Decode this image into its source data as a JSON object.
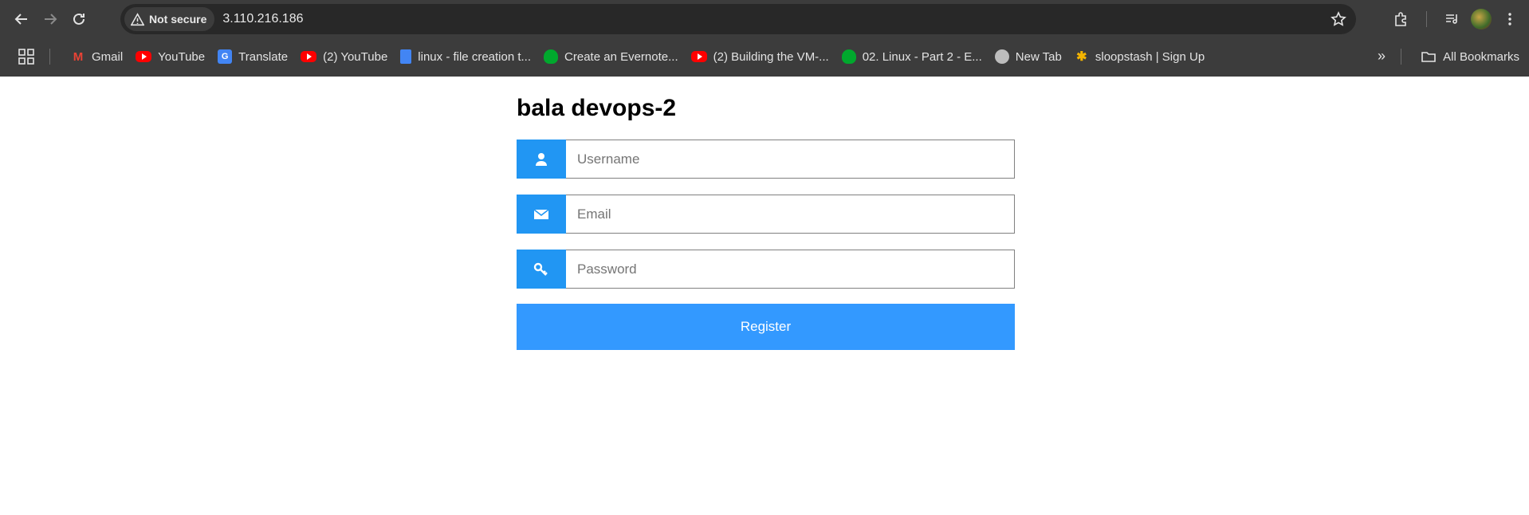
{
  "browser": {
    "security_label": "Not secure",
    "url": "3.110.216.186",
    "bookmarks": [
      {
        "label": "Gmail",
        "icon": "gmail-icon"
      },
      {
        "label": "YouTube",
        "icon": "youtube-icon"
      },
      {
        "label": "Translate",
        "icon": "translate-icon"
      },
      {
        "label": "(2) YouTube",
        "icon": "youtube-icon"
      },
      {
        "label": "linux - file creation t...",
        "icon": "docs-icon"
      },
      {
        "label": "Create an Evernote...",
        "icon": "evernote-icon"
      },
      {
        "label": "(2) Building the VM-...",
        "icon": "youtube-icon"
      },
      {
        "label": "02. Linux - Part 2 - E...",
        "icon": "evernote-icon"
      },
      {
        "label": "New Tab",
        "icon": "globe-icon"
      },
      {
        "label": "sloopstash | Sign Up",
        "icon": "sloopstash-icon"
      }
    ],
    "all_bookmarks_label": "All Bookmarks"
  },
  "page": {
    "title": "bala devops-2",
    "username_placeholder": "Username",
    "email_placeholder": "Email",
    "password_placeholder": "Password",
    "register_label": "Register"
  },
  "colors": {
    "addon_blue": "#2196f3",
    "button_blue": "#3399ff"
  }
}
